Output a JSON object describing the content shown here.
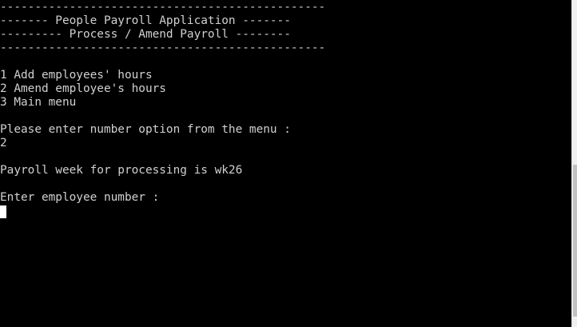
{
  "terminal": {
    "header": {
      "rule_top": "-----------------------------------------------",
      "title": "------- People Payroll Application -------",
      "subtitle": "--------- Process / Amend Payroll --------",
      "rule_bottom": "-----------------------------------------------"
    },
    "menu": {
      "item_1": "1 Add employees' hours",
      "item_2": "2 Amend employee's hours",
      "item_3": "3 Main menu"
    },
    "prompt": "Please enter number option from the menu :",
    "input_value": "2",
    "payroll_week_message": "Payroll week for processing is wk26",
    "employee_prompt": "Enter employee number :",
    "colors": {
      "background": "#000000",
      "text": "#d0d0d0",
      "cursor": "#ffffff"
    }
  }
}
